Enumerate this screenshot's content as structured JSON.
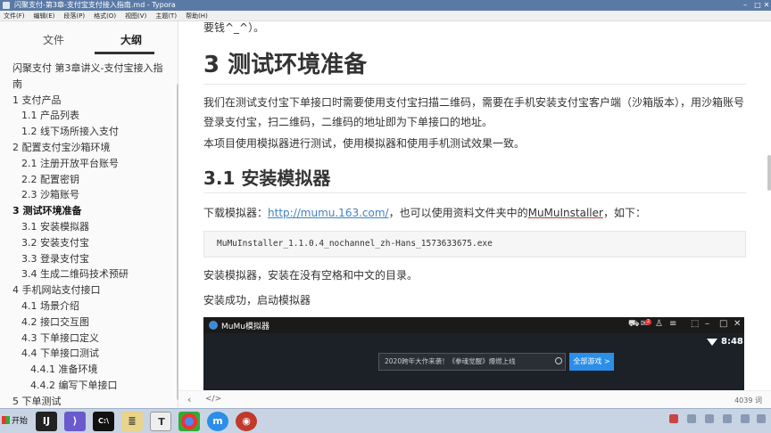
{
  "window": {
    "title": "闪聚支付-第3章-支付宝支付接入指南.md - Typora"
  },
  "menu": [
    "文件(F)",
    "编辑(E)",
    "段落(P)",
    "格式(O)",
    "视图(V)",
    "主题(T)",
    "帮助(H)"
  ],
  "sidebar": {
    "tab_files": "文件",
    "tab_outline": "大纲",
    "outline": [
      {
        "label": "闪聚支付 第3章讲义-支付宝接入指",
        "level": 0
      },
      {
        "label": "南",
        "level": 0
      },
      {
        "label": "1 支付产品",
        "level": 1
      },
      {
        "label": "1.1 产品列表",
        "level": 2
      },
      {
        "label": "1.2 线下场所接入支付",
        "level": 2
      },
      {
        "label": "2 配置支付宝沙箱环境",
        "level": 1
      },
      {
        "label": "2.1 注册开放平台账号",
        "level": 2
      },
      {
        "label": "2.2 配置密钥",
        "level": 2
      },
      {
        "label": "2.3 沙箱账号",
        "level": 2
      },
      {
        "label": "3 测试环境准备",
        "level": 1,
        "active": true
      },
      {
        "label": "3.1 安装模拟器",
        "level": 2
      },
      {
        "label": "3.2 安装支付宝",
        "level": 2
      },
      {
        "label": "3.3 登录支付宝",
        "level": 2
      },
      {
        "label": "3.4 生成二维码技术预研",
        "level": 2
      },
      {
        "label": "4 手机网站支付接口",
        "level": 1
      },
      {
        "label": "4.1 场景介绍",
        "level": 2
      },
      {
        "label": "4.2 接口交互图",
        "level": 2
      },
      {
        "label": "4.3 下单接口定义",
        "level": 2
      },
      {
        "label": "4.4 下单接口测试",
        "level": 2
      },
      {
        "label": "4.4.1 准备环境",
        "level": 3
      },
      {
        "label": "4.4.2 编写下单接口",
        "level": 3
      },
      {
        "label": "5 下单测试",
        "level": 1
      }
    ]
  },
  "editor": {
    "fragment_top": "要钱^_^）。",
    "h1": "3 测试环境准备",
    "p1": "我们在测试支付宝下单接口时需要使用支付宝扫描二维码，需要在手机安装支付宝客户端（沙箱版本），用沙箱账号登录支付宝，扫二维码，二维码的地址即为下单接口的地址。",
    "p2": "本项目使用模拟器进行测试，使用模拟器和使用手机测试效果一致。",
    "h2": "3.1 安装模拟器",
    "p3_prefix": "下载模拟器：",
    "p3_link": "http://mumu.163.com/",
    "p3_mid": "，也可以使用资料文件夹中的",
    "p3_file": "MuMuInstaller",
    "p3_suffix": "，如下：",
    "code": "MuMuInstaller_1.1.0.4_nochannel_zh-Hans_1573633675.exe",
    "p4": "安装模拟器，安装在没有空格和中文的目录。",
    "p5": "安装成功，启动模拟器"
  },
  "mumu": {
    "app_name": "MuMu模拟器",
    "badge": "2",
    "clock": "8:48",
    "search_text": "2020跨年大作来袭！《拳魂觉醒》爆燃上线",
    "all_games_button": "全部游戏 >"
  },
  "statusbar": {
    "left_arrow": "‹",
    "code_toggle": "</>",
    "word_count": "4039 词"
  },
  "taskbar": {
    "start": "开始"
  }
}
